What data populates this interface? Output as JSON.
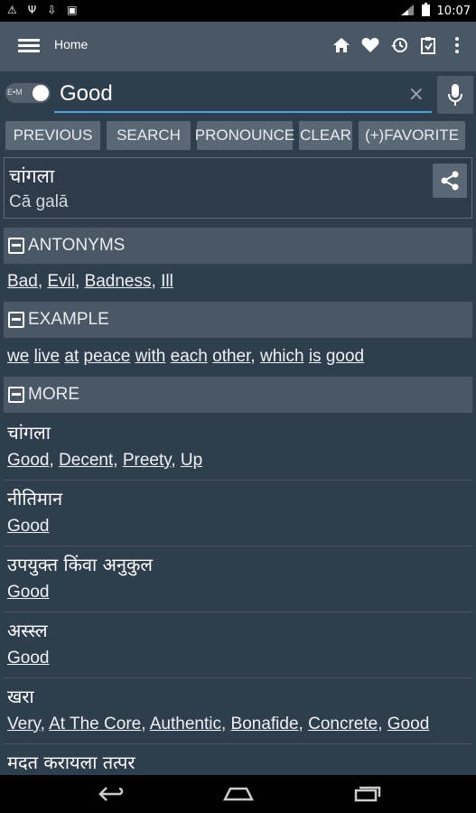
{
  "status": {
    "time": "10:07"
  },
  "appbar": {
    "title": "Home"
  },
  "search": {
    "toggle_label": "E•M",
    "value": "Good",
    "clear_symbol": "×"
  },
  "buttons": {
    "previous": "PREVIOUS",
    "search": "SEARCH",
    "pronounce": "PRONOUNCE",
    "clear": "CLEAR",
    "favorite": "(+)FAVORITE"
  },
  "result": {
    "word": "चांगला",
    "transliteration": "Cā galā"
  },
  "sections": {
    "antonyms": {
      "title": "ANTONYMS",
      "items": [
        "Bad",
        "Evil",
        "Badness",
        "Ill"
      ]
    },
    "example": {
      "title": "EXAMPLE",
      "words": [
        "we",
        "live",
        "at",
        "peace",
        "with",
        "each",
        "other",
        "which",
        "is",
        "good"
      ]
    },
    "more": {
      "title": "MORE"
    }
  },
  "more_items": [
    {
      "word": "चांगला",
      "synonyms": [
        "Good",
        "Decent",
        "Preety",
        "Up"
      ]
    },
    {
      "word": "नीतिमान",
      "synonyms": [
        "Good"
      ]
    },
    {
      "word": "उपयुक्त किंवा अनुकुल",
      "synonyms": [
        "Good"
      ]
    },
    {
      "word": "अस्स्ल",
      "synonyms": [
        "Good"
      ]
    },
    {
      "word": "खरा",
      "synonyms": [
        "Very",
        "At The Core",
        "Authentic",
        "Bonafide",
        "Concrete",
        "Good"
      ]
    },
    {
      "word": "मदत करायला तत्पर",
      "synonyms": []
    }
  ],
  "colors": {
    "appbar": "#4a5866",
    "background": "#2f3e4d",
    "section": "#4a5764",
    "button": "#5a6775",
    "accent": "#4aa3df"
  }
}
